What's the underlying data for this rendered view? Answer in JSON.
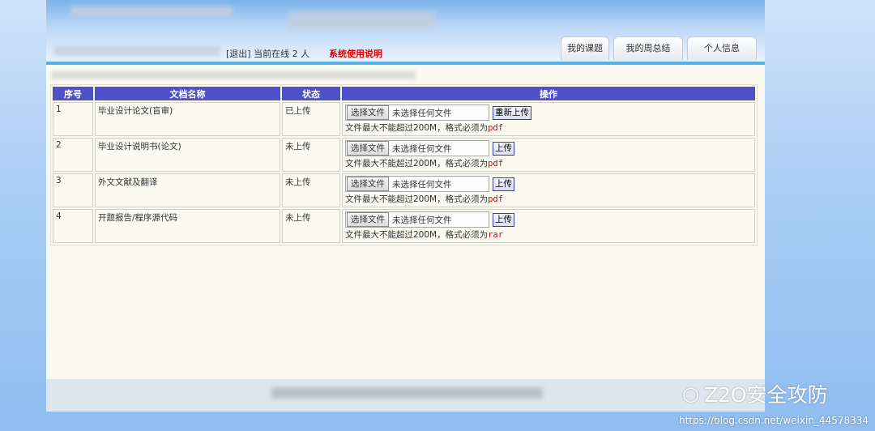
{
  "header": {
    "logout": "[退出]",
    "online": "当前在线 2 人",
    "help": "系统使用说明",
    "tabs": [
      "我的课题",
      "我的周总结",
      "个人信息"
    ]
  },
  "table": {
    "columns": [
      "序号",
      "文档名称",
      "状态",
      "操作"
    ],
    "choose_label": "选择文件",
    "no_file_label": "未选择任何文件",
    "note_prefix": "文件最大不能超过200M，格式必须为",
    "rows": [
      {
        "idx": "1",
        "name": "毕业设计论文(盲审)",
        "status": "已上传",
        "action": "重新上传",
        "format": "pdf"
      },
      {
        "idx": "2",
        "name": "毕业设计说明书(论文)",
        "status": "未上传",
        "action": "上传",
        "format": "pdf"
      },
      {
        "idx": "3",
        "name": "外文文献及翻译",
        "status": "未上传",
        "action": "上传",
        "format": "pdf"
      },
      {
        "idx": "4",
        "name": "开题报告/程序源代码",
        "status": "未上传",
        "action": "上传",
        "format": "rar"
      }
    ]
  },
  "watermark": {
    "brand": "Z2O安全攻防",
    "url": "https://blog.csdn.net/weixin_44578334",
    "icon": "wechat-icon"
  },
  "colors": {
    "header_bar": "#5050c8",
    "accent_red": "#e00000",
    "header_line": "#56b1e8"
  }
}
